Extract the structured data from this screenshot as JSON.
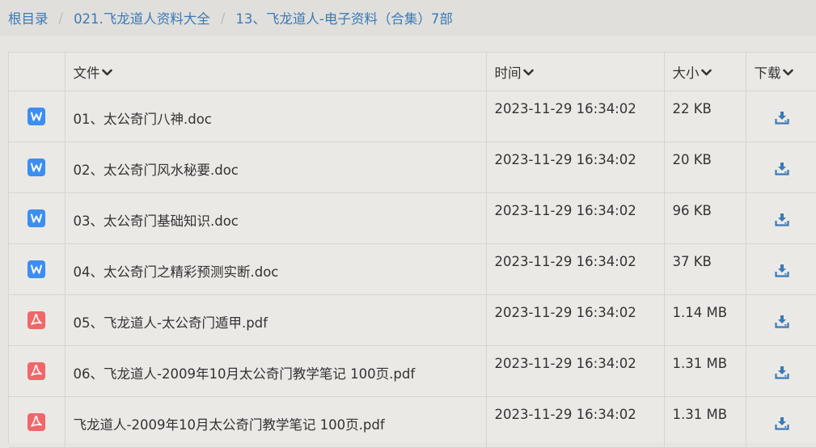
{
  "breadcrumb": {
    "items": [
      "根目录",
      "021.飞龙道人资料大全",
      "13、飞龙道人-电子资料（合集）7部"
    ]
  },
  "table": {
    "headers": {
      "name": "文件",
      "time": "时间",
      "size": "大小",
      "download": "下载"
    },
    "rows": [
      {
        "type": "doc",
        "name": "01、太公奇门八神.doc",
        "time": "2023-11-29 16:34:02",
        "size": "22 KB"
      },
      {
        "type": "doc",
        "name": "02、太公奇门风水秘要.doc",
        "time": "2023-11-29 16:34:02",
        "size": "20 KB"
      },
      {
        "type": "doc",
        "name": "03、太公奇门基础知识.doc",
        "time": "2023-11-29 16:34:02",
        "size": "96 KB"
      },
      {
        "type": "doc",
        "name": "04、太公奇门之精彩预测实断.doc",
        "time": "2023-11-29 16:34:02",
        "size": "37 KB"
      },
      {
        "type": "pdf",
        "name": "05、飞龙道人-太公奇门遁甲.pdf",
        "time": "2023-11-29 16:34:02",
        "size": "1.14 MB"
      },
      {
        "type": "pdf",
        "name": "06、飞龙道人-2009年10月太公奇门教学笔记 100页.pdf",
        "time": "2023-11-29 16:34:02",
        "size": "1.31 MB"
      },
      {
        "type": "pdf",
        "name": "飞龙道人-2009年10月太公奇门教学笔记 100页.pdf",
        "time": "2023-11-29 16:34:02",
        "size": "1.31 MB"
      }
    ]
  },
  "icons": {
    "sort": "chevron-down-icon",
    "doc": "word-doc-icon",
    "pdf": "pdf-icon",
    "download": "download-icon"
  },
  "colors": {
    "link": "#3a7ab8",
    "doc_icon": "#3d8ef0",
    "pdf_icon": "#f0676a",
    "download_icon": "#3a7ab8"
  }
}
